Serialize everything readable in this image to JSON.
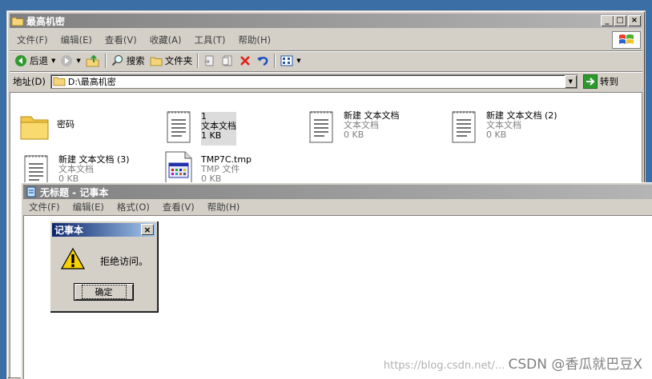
{
  "explorer": {
    "title": "最高机密",
    "menu": [
      "文件(F)",
      "编辑(E)",
      "查看(V)",
      "收藏(A)",
      "工具(T)",
      "帮助(H)"
    ],
    "toolbar": {
      "back": "后退",
      "search": "搜索",
      "folders": "文件夹"
    },
    "address": {
      "label": "地址(D)",
      "value": "D:\\最高机密",
      "go": "转到"
    },
    "files": [
      {
        "name": "密码",
        "type": "",
        "size": ""
      },
      {
        "name": "1",
        "type": "文本文档",
        "size": "1 KB"
      },
      {
        "name": "新建 文本文档",
        "type": "文本文档",
        "size": "0 KB"
      },
      {
        "name": "新建 文本文档 (2)",
        "type": "文本文档",
        "size": "0 KB"
      },
      {
        "name": "新建 文本文档 (3)",
        "type": "文本文档",
        "size": "0 KB"
      },
      {
        "name": "TMP7C.tmp",
        "type": "TMP 文件",
        "size": "0 KB"
      }
    ]
  },
  "notepad": {
    "title": "无标题 - 记事本",
    "menu": [
      "文件(F)",
      "编辑(E)",
      "格式(O)",
      "查看(V)",
      "帮助(H)"
    ]
  },
  "dialog": {
    "title": "记事本",
    "message": "拒绝访问。",
    "ok": "确定"
  },
  "watermark": {
    "faint": "https://blog.csdn.net/...",
    "text": "CSDN @香瓜就巴豆X"
  },
  "colors": {
    "desktop": "#3a6ea5",
    "inactive_title": "#808080",
    "active_title": "#0a246a",
    "face": "#d4d0c8"
  }
}
